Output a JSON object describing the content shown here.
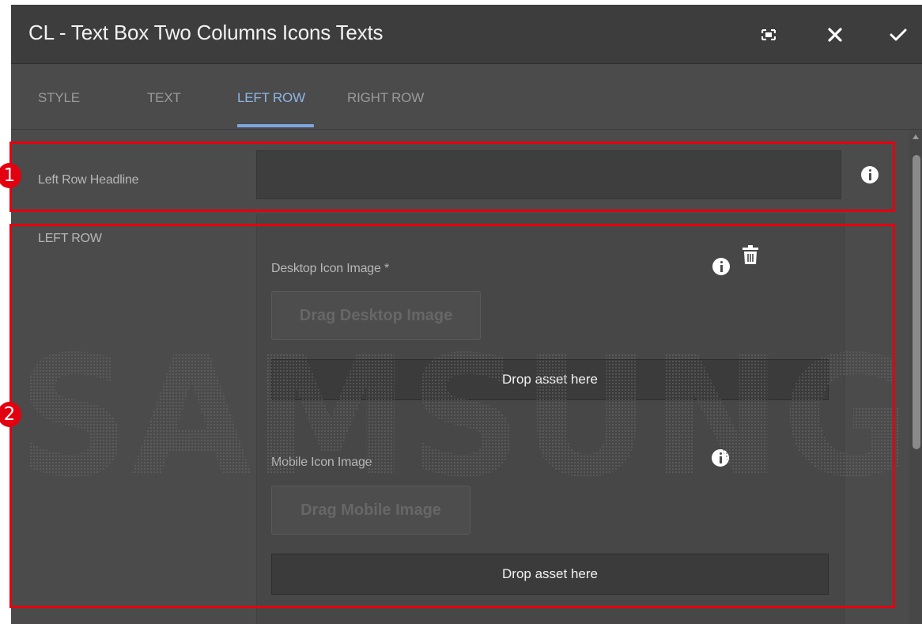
{
  "dialog": {
    "title": "CL - Text Box Two Columns Icons Texts",
    "buttons": {
      "fullscreen_icon": "fullscreen-icon",
      "close_icon": "close-icon",
      "done_icon": "checkmark-icon"
    }
  },
  "tabs": [
    {
      "label": "STYLE",
      "active": false
    },
    {
      "label": "TEXT",
      "active": false
    },
    {
      "label": "LEFT ROW",
      "active": true
    },
    {
      "label": "RIGHT ROW",
      "active": false
    }
  ],
  "form": {
    "left_row_headline": {
      "label": "Left Row Headline",
      "value": "",
      "placeholder": ""
    },
    "left_row": {
      "label": "LEFT ROW",
      "desktop_icon": {
        "label": "Desktop Icon Image *",
        "drag_label": "Drag Desktop Image",
        "drop_label": "Drop asset here"
      },
      "mobile_icon": {
        "label": "Mobile Icon Image",
        "drag_label": "Drag Mobile Image",
        "drop_label": "Drop asset here"
      }
    }
  },
  "watermark": {
    "text": "SAMSUNG"
  },
  "annotations": [
    {
      "number": "1"
    },
    {
      "number": "2"
    }
  ],
  "colors": {
    "accent": "#7ea6df",
    "highlight": "#e3000f",
    "panel_bg": "#4b4b4b",
    "titlebar_bg": "#3d3d3d"
  }
}
